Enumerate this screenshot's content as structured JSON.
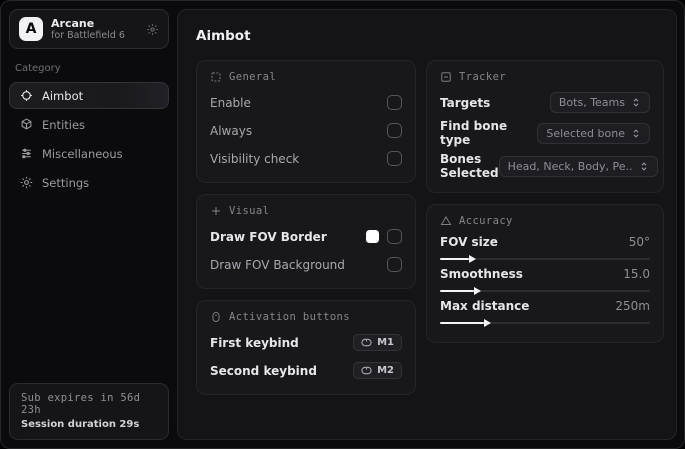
{
  "app": {
    "logo_letter": "A",
    "name": "Arcane",
    "subtitle": "for Battlefield 6"
  },
  "sidebar": {
    "category_label": "Category",
    "items": [
      {
        "label": "Aimbot"
      },
      {
        "label": "Entities"
      },
      {
        "label": "Miscellaneous"
      },
      {
        "label": "Settings"
      }
    ],
    "subscription": {
      "expires": "Sub expires in 56d 23h",
      "session": "Session duration 29s"
    }
  },
  "main": {
    "title": "Aimbot",
    "general": {
      "title": "General",
      "rows": [
        {
          "label": "Enable",
          "checked": false
        },
        {
          "label": "Always",
          "checked": false
        },
        {
          "label": "Visibility check",
          "checked": false
        }
      ]
    },
    "visual": {
      "title": "Visual",
      "rows": [
        {
          "label": "Draw FOV Border",
          "swatch_color": "#ffffff",
          "checked": false
        },
        {
          "label": "Draw FOV Background",
          "checked": false
        }
      ]
    },
    "activation": {
      "title": "Activation buttons",
      "rows": [
        {
          "label": "First keybind",
          "key": "M1"
        },
        {
          "label": "Second keybind",
          "key": "M2"
        }
      ]
    },
    "tracker": {
      "title": "Tracker",
      "rows": [
        {
          "label": "Targets",
          "value": "Bots, Teams"
        },
        {
          "label": "Find bone type",
          "value": "Selected bone"
        },
        {
          "label": "Bones Selected",
          "value": "Head, Neck, Body, Pe.."
        }
      ]
    },
    "accuracy": {
      "title": "Accuracy",
      "sliders": [
        {
          "label": "FOV size",
          "value": "50°",
          "fill_percent": 14
        },
        {
          "label": "Smoothness",
          "value": "15.0",
          "fill_percent": 16
        },
        {
          "label": "Max distance",
          "value": "250m",
          "fill_percent": 21
        }
      ]
    }
  },
  "colors": {
    "background": "#0b0b0d",
    "panel": "#18181b",
    "accent_fill": "#f5f5f7",
    "swatch_white": "#ffffff"
  }
}
